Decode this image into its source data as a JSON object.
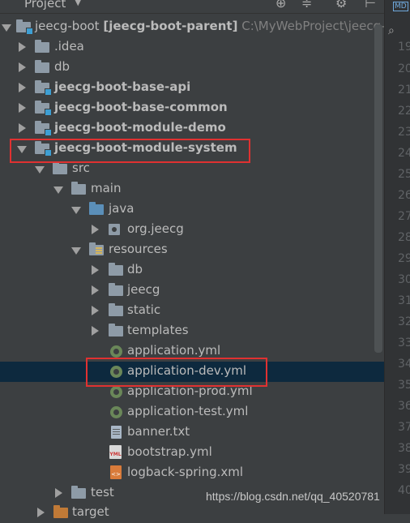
{
  "toolbar": {
    "title": "Project",
    "dropdown_icon": "chevron-down-icon",
    "icons": [
      "target-icon",
      "collapse-all-icon",
      "gear-icon",
      "hide-icon"
    ]
  },
  "tree": {
    "root": {
      "label": "jeecg-boot",
      "module": "[jeecg-boot-parent]",
      "path": "C:\\MyWebProject\\jeecg-"
    },
    "items": [
      {
        "label": ".idea"
      },
      {
        "label": "db"
      },
      {
        "label": "jeecg-boot-base-api"
      },
      {
        "label": "jeecg-boot-base-common"
      },
      {
        "label": "jeecg-boot-module-demo"
      },
      {
        "label": "jeecg-boot-module-system"
      },
      {
        "label": "src"
      },
      {
        "label": "main"
      },
      {
        "label": "java"
      },
      {
        "label": "org.jeecg"
      },
      {
        "label": "resources"
      },
      {
        "label": "db"
      },
      {
        "label": "jeecg"
      },
      {
        "label": "static"
      },
      {
        "label": "templates"
      },
      {
        "label": "application.yml"
      },
      {
        "label": "application-dev.yml"
      },
      {
        "label": "application-prod.yml"
      },
      {
        "label": "application-test.yml"
      },
      {
        "label": "banner.txt"
      },
      {
        "label": "bootstrap.yml"
      },
      {
        "label": "logback-spring.xml"
      },
      {
        "label": "test"
      },
      {
        "label": "target"
      }
    ]
  },
  "gutter": {
    "line_numbers": [
      "19",
      "20",
      "21",
      "22",
      "23",
      "24",
      "25",
      "26",
      "27",
      "28",
      "29",
      "30",
      "31",
      "32",
      "33",
      "34",
      "35",
      "36",
      "37",
      "38",
      "39",
      "40"
    ],
    "badge": "MD"
  },
  "icons": {
    "yml": "YML",
    "xml": "<>"
  },
  "watermark": "https://blog.csdn.net/qq_40520781",
  "colors": {
    "background": "#3c3f41",
    "selection": "#0d293e",
    "highlight_box": "#e03131",
    "module_badge": "#3d9fd4"
  }
}
